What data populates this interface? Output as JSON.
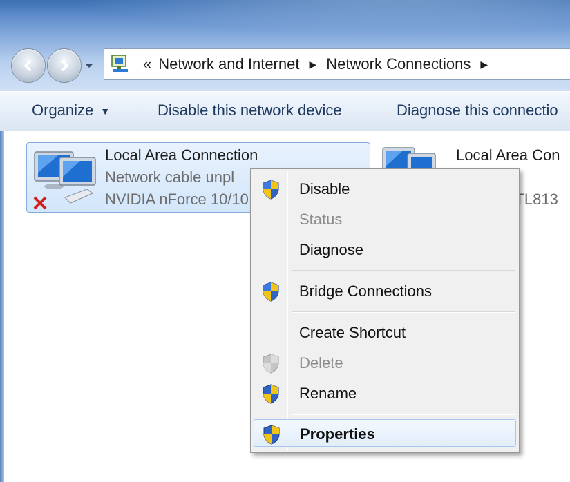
{
  "address": {
    "overflow": "«",
    "crumbs": [
      "Network and Internet",
      "Network Connections"
    ]
  },
  "toolbar": {
    "organize": "Organize",
    "disable": "Disable this network device",
    "diagnose": "Diagnose this connectio"
  },
  "items": [
    {
      "name": "Local Area Connection",
      "status": "Network cable unpl",
      "device": "NVIDIA nForce 10/10"
    },
    {
      "name": "Local Area Con",
      "device": "RTL813"
    }
  ],
  "menu": {
    "disable": "Disable",
    "status": "Status",
    "diagnose": "Diagnose",
    "bridge": "Bridge Connections",
    "shortcut": "Create Shortcut",
    "delete": "Delete",
    "rename": "Rename",
    "properties": "Properties"
  },
  "icons": {
    "back": "back-arrow-icon",
    "forward": "forward-arrow-icon",
    "shield": "uac-shield-icon",
    "network": "network-connection-icon"
  },
  "colors": {
    "title_gradient_top": "#3a6fb3",
    "toolbar_text": "#1e3a5e",
    "selection_border": "#84acdd",
    "menu_highlight_border": "#a7c6ed"
  }
}
